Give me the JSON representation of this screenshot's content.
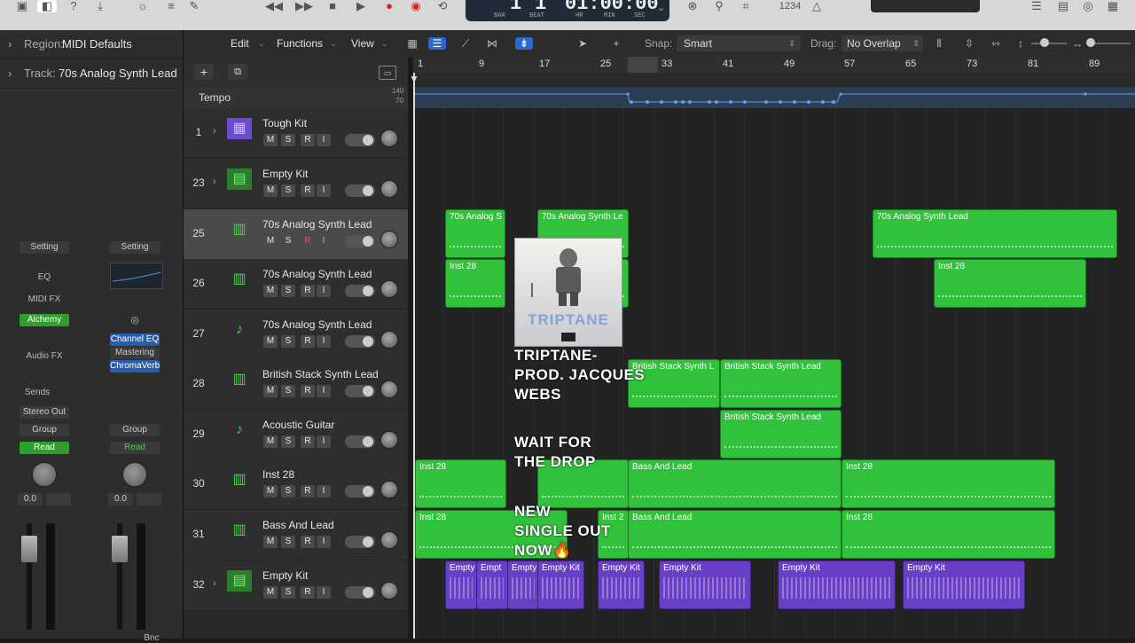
{
  "toolbar": {
    "lcd_bar": "1",
    "lcd_beat": "1",
    "lcd_time": "01:00:00",
    "lcd_labels": [
      "BAR",
      "BEAT",
      "HR",
      "MIN",
      "SEC"
    ],
    "count_in": "1234"
  },
  "inspector": {
    "region_label": "Region:",
    "region_value": "MIDI Defaults",
    "track_label": "Track:",
    "track_value": "70s Analog Synth Lead",
    "strip1": {
      "setting": "Setting",
      "eq": "EQ",
      "midi_fx": "MIDI FX",
      "instrument": "Alchemy",
      "audio_fx": "Audio FX",
      "sends": "Sends",
      "output": "Stereo Out",
      "group": "Group",
      "automation": "Read",
      "pan_value": "0.0"
    },
    "strip2": {
      "setting": "Setting",
      "fx1": "Channel EQ",
      "fx2": "Mastering",
      "fx3": "ChromaVerb",
      "group": "Group",
      "automation": "Read",
      "pan_value": "0.0"
    },
    "bottom_label": "Bnc"
  },
  "menus": {
    "edit": "Edit",
    "functions": "Functions",
    "view": "View",
    "snap_label": "Snap:",
    "snap_value": "Smart",
    "drag_label": "Drag:",
    "drag_value": "No Overlap"
  },
  "ruler": [
    "1",
    "9",
    "17",
    "25",
    "33",
    "41",
    "49",
    "57",
    "65",
    "73",
    "81",
    "89"
  ],
  "tempo": {
    "label": "Tempo",
    "high": "140",
    "low": "70"
  },
  "tracks": [
    {
      "num": "1",
      "name": "Tough Kit"
    },
    {
      "num": "23",
      "name": "Empty Kit"
    },
    {
      "num": "25",
      "name": "70s Analog Synth Lead"
    },
    {
      "num": "26",
      "name": "70s Analog Synth Lead"
    },
    {
      "num": "27",
      "name": "70s Analog Synth Lead"
    },
    {
      "num": "28",
      "name": "British Stack Synth Lead"
    },
    {
      "num": "29",
      "name": "Acoustic Guitar"
    },
    {
      "num": "30",
      "name": "Inst 28"
    },
    {
      "num": "31",
      "name": "Bass And Lead"
    },
    {
      "num": "32",
      "name": "Empty Kit"
    }
  ],
  "buttons": {
    "m": "M",
    "s": "S",
    "r": "R",
    "i": "I"
  },
  "regions": [
    "70s Analog S",
    "70s Analog Synth Le",
    "70s Analog Synth Lead",
    "Inst 28",
    "Inst 28",
    "British Stack Synth L",
    "British Stack Synth Lead",
    "British Stack Synth Lead",
    "Inst 28",
    "Bass And Lead",
    "Inst 28",
    "Inst 28",
    "Inst 2",
    "Bass And Lead",
    "Inst 28",
    "Empty",
    "Empt",
    "Empty",
    "Empty Kit",
    "Empty Kit",
    "Empty Kit",
    "Empty Kit",
    "Empty Kit"
  ],
  "overlay": {
    "album_title": "TRIPTANE",
    "line1": "TRIPTANE-\nPROD. JACQUES\nWEBS",
    "line2": "WAIT FOR\nTHE DROP",
    "line3": "NEW\nSINGLE OUT\nNOW🔥"
  }
}
